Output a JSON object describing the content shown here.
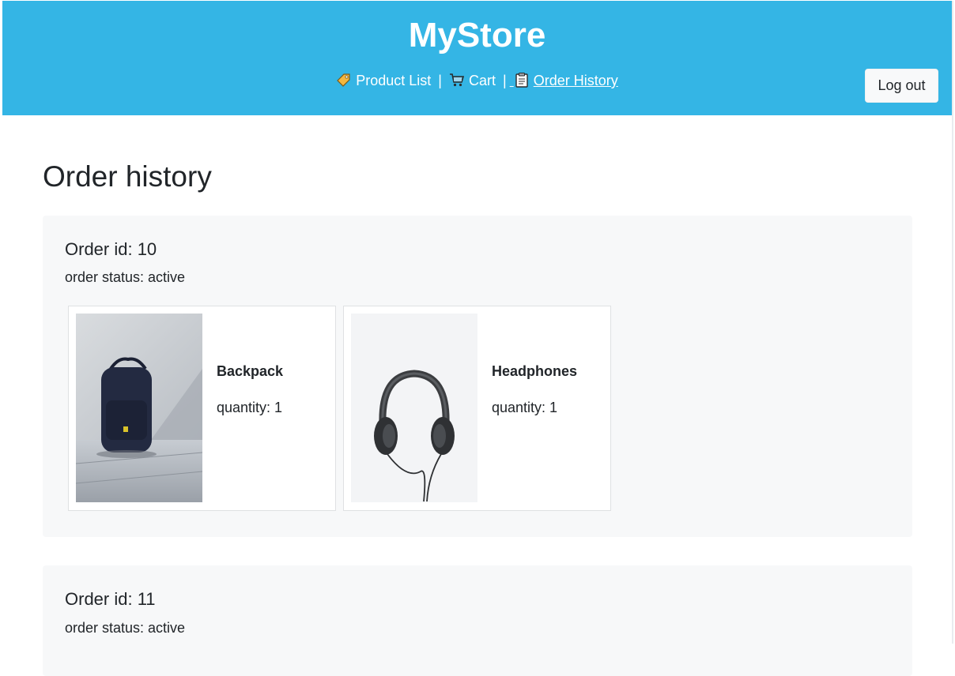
{
  "header": {
    "brand": "MyStore",
    "nav": [
      {
        "label": "Product List",
        "icon": "tag-icon"
      },
      {
        "label": "Cart",
        "icon": "cart-icon"
      },
      {
        "label": "Order History",
        "icon": "clipboard-icon",
        "active": true
      }
    ],
    "separator": "|",
    "logout_label": "Log out"
  },
  "page": {
    "title": "Order history"
  },
  "orders": [
    {
      "title": "Order id: 10",
      "status": "order status: active",
      "items": [
        {
          "name": "Backpack",
          "quantity": "quantity: 1",
          "image": "backpack-photo"
        },
        {
          "name": "Headphones",
          "quantity": "quantity: 1",
          "image": "headphones-photo"
        }
      ]
    },
    {
      "title": "Order id: 11",
      "status": "order status: active",
      "items": []
    }
  ],
  "colors": {
    "header_bg": "#34b5e5",
    "order_bg": "#f7f8f9",
    "text": "#212529"
  }
}
